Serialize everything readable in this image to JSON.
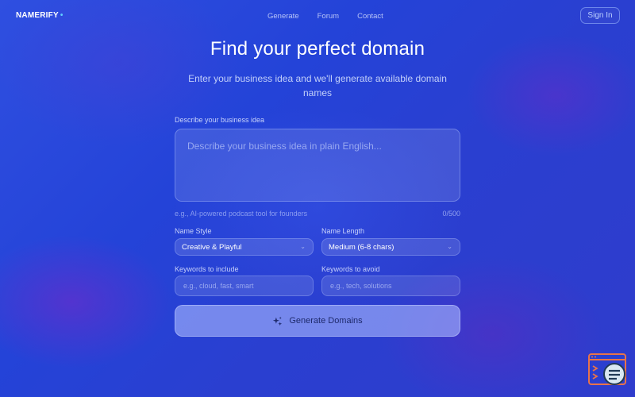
{
  "nav": {
    "logo": "NAMERIFY",
    "logo_dot": "•",
    "links": [
      "Generate",
      "Forum",
      "Contact"
    ],
    "signin": "Sign In"
  },
  "hero": {
    "title": "Find your perfect domain",
    "subtitle": "Enter your business idea and we'll generate available domain names"
  },
  "form": {
    "idea_label": "Describe your business idea",
    "idea_placeholder": "Describe your business idea in plain English...",
    "idea_hint": "e.g., AI-powered podcast tool for founders",
    "idea_counter": "0/500",
    "style_label": "Name Style",
    "style_value": "Creative & Playful",
    "length_label": "Name Length",
    "length_value": "Medium (6-8 chars)",
    "include_label": "Keywords to include",
    "include_placeholder": "e.g., cloud, fast, smart",
    "avoid_label": "Keywords to avoid",
    "avoid_placeholder": "e.g., tech, solutions",
    "generate_label": "Generate Domains"
  },
  "colors": {
    "accent_dot": "#5fd0ff",
    "button_bg": "#aab9ff"
  }
}
